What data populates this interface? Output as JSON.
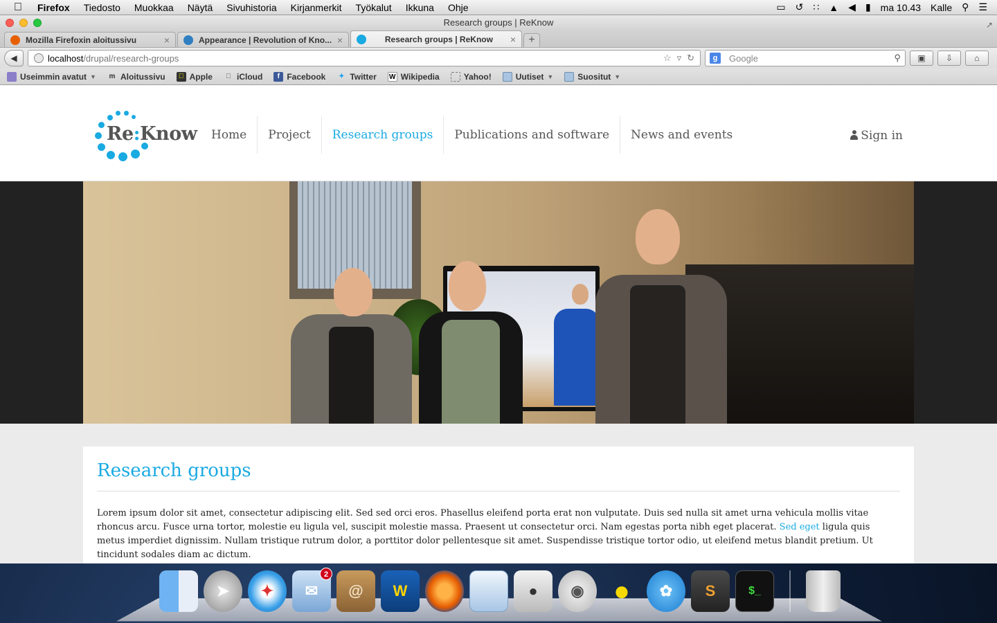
{
  "menubar": {
    "app": "Firefox",
    "items": [
      "Tiedosto",
      "Muokkaa",
      "Näytä",
      "Sivuhistoria",
      "Kirjanmerkit",
      "Työkalut",
      "Ikkuna",
      "Ohje"
    ],
    "clock": "ma 10.43",
    "user": "Kalle"
  },
  "window": {
    "title": "Research groups | ReKnow"
  },
  "tabs": [
    {
      "label": "Mozilla Firefoxin aloitussivu",
      "favicon_color": "#e66000"
    },
    {
      "label": "Appearance | Revolution of Kno...",
      "favicon_color": "#2f7fc1"
    },
    {
      "label": "Research groups | ReKnow",
      "favicon_color": "#1aaae2"
    }
  ],
  "navbar": {
    "url_host": "localhost",
    "url_path": "/drupal/research-groups",
    "search_placeholder": "Google"
  },
  "bookmarks": [
    {
      "label": "Useimmin avatut",
      "icon": "folder-icon",
      "dropdown": true
    },
    {
      "label": "Aloitussivu",
      "icon": "m-icon",
      "dropdown": false
    },
    {
      "label": "Apple",
      "icon": "apple-icon",
      "dropdown": false
    },
    {
      "label": "iCloud",
      "icon": "apple-icon",
      "dropdown": false
    },
    {
      "label": "Facebook",
      "icon": "facebook-icon",
      "dropdown": false
    },
    {
      "label": "Twitter",
      "icon": "twitter-icon",
      "dropdown": false
    },
    {
      "label": "Wikipedia",
      "icon": "wikipedia-icon",
      "dropdown": false
    },
    {
      "label": "Yahoo!",
      "icon": "page-icon",
      "dropdown": false
    },
    {
      "label": "Uutiset",
      "icon": "folder-icon",
      "dropdown": true
    },
    {
      "label": "Suositut",
      "icon": "folder-icon",
      "dropdown": true
    }
  ],
  "site": {
    "logo_text_left": "Re",
    "logo_text_colon": ":",
    "logo_text_right": "Know",
    "nav": [
      "Home",
      "Project",
      "Research groups",
      "Publications and software",
      "News and events"
    ],
    "active_nav": "Research groups",
    "signin": "Sign in",
    "accent": "#1aaae2"
  },
  "content": {
    "heading": "Research groups",
    "para_start": "Lorem ipsum dolor sit amet, consectetur adipiscing elit. Sed sed orci eros. Phasellus eleifend porta erat non vulputate. Duis sed nulla sit amet urna vehicula mollis vitae rhoncus arcu. Fusce urna tortor, molestie eu ligula vel, suscipit molestie massa. Praesent ut consectetur orci. Nam egestas porta nibh eget placerat. ",
    "link_text": "Sed eget",
    "para_end": " ligula quis metus imperdiet dignissim. Nullam tristique rutrum dolor, a porttitor dolor pellentesque sit amet. Suspendisse tristique tortor odio, ut eleifend metus blandit pretium. Ut tincidunt sodales diam ac dictum."
  },
  "dock": {
    "mail_badge": "2"
  }
}
